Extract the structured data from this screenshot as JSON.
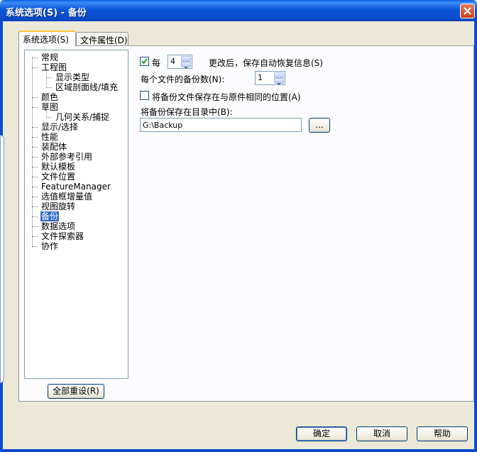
{
  "window": {
    "title": "系统选项(S) - 备份"
  },
  "tabs": [
    {
      "label": "系统选项(S)",
      "active": true
    },
    {
      "label": "文件属性(D)",
      "active": false
    }
  ],
  "tree": {
    "items": [
      {
        "label": "常规",
        "level": 0,
        "selected": false
      },
      {
        "label": "工程图",
        "level": 0,
        "selected": false
      },
      {
        "label": "显示类型",
        "level": 1,
        "selected": false
      },
      {
        "label": "区域剖面线/填充",
        "level": 1,
        "selected": false
      },
      {
        "label": "颜色",
        "level": 0,
        "selected": false
      },
      {
        "label": "草图",
        "level": 0,
        "selected": false
      },
      {
        "label": "几何关系/捕捉",
        "level": 1,
        "selected": false
      },
      {
        "label": "显示/选择",
        "level": 0,
        "selected": false
      },
      {
        "label": "性能",
        "level": 0,
        "selected": false
      },
      {
        "label": "装配体",
        "level": 0,
        "selected": false
      },
      {
        "label": "外部参考引用",
        "level": 0,
        "selected": false
      },
      {
        "label": "默认模板",
        "level": 0,
        "selected": false
      },
      {
        "label": "文件位置",
        "level": 0,
        "selected": false
      },
      {
        "label": "FeatureManager",
        "level": 0,
        "selected": false
      },
      {
        "label": "选值框增量值",
        "level": 0,
        "selected": false
      },
      {
        "label": "视图旋转",
        "level": 0,
        "selected": false
      },
      {
        "label": "备份",
        "level": 0,
        "selected": true
      },
      {
        "label": "数据选项",
        "level": 0,
        "selected": false
      },
      {
        "label": "文件探索器",
        "level": 0,
        "selected": false
      },
      {
        "label": "协作",
        "level": 0,
        "selected": false
      }
    ]
  },
  "reset_button": "全部重设(R)",
  "backup": {
    "every_checkbox_label": "每",
    "every_checked": true,
    "every_value": "4",
    "every_suffix": "更改后，保存自动恢复信息(S)",
    "copies_label": "每个文件的备份数(N):",
    "copies_value": "1",
    "same_location_label": "将备份文件保存在与原件相同的位置(A)",
    "same_location_checked": false,
    "dir_label": "将备份保存在目录中(B):",
    "dir_value": "G:\\Backup",
    "browse_label": "..."
  },
  "footer": {
    "ok": "确定",
    "cancel": "取消",
    "help": "帮助"
  }
}
